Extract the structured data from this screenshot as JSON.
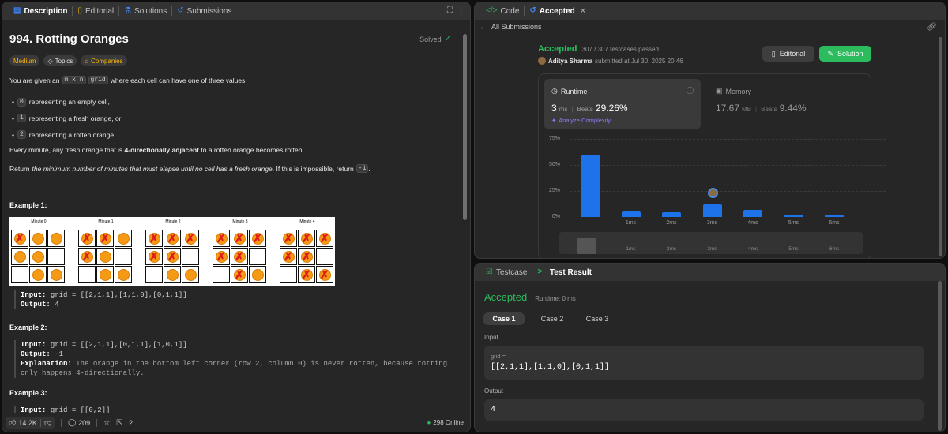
{
  "left_tabs": {
    "description": "Description",
    "editorial": "Editorial",
    "solutions": "Solutions",
    "submissions": "Submissions"
  },
  "problem": {
    "title": "994. Rotting Oranges",
    "solved": "Solved",
    "difficulty": "Medium",
    "topics": "Topics",
    "companies": "Companies",
    "intro_pre": "You are given an",
    "intro_code": "m x n",
    "intro_code2": "grid",
    "intro_post": "where each cell can have one of three values:",
    "bullets": [
      {
        "code": "0",
        "text": "representing an empty cell,"
      },
      {
        "code": "1",
        "text": "representing a fresh orange, or"
      },
      {
        "code": "2",
        "text": "representing a rotten orange."
      }
    ],
    "p2_pre": "Every minute, any fresh orange that is",
    "p2_bold": "4-directionally adjacent",
    "p2_post": "to a rotten orange becomes rotten.",
    "p3_pre": "Return",
    "p3_italic": "the minimum number of minutes that must elapse until no cell has a fresh orange",
    "p3_post": ". If this is impossible, return",
    "p3_code": "-1",
    "p3_end": ".",
    "ex1_title": "Example 1:",
    "minutes": [
      "Minute 0",
      "Minute 1",
      "Minute 2",
      "Minute 3",
      "Minute 4"
    ],
    "ex1_input_label": "Input:",
    "ex1_input": "grid = [[2,1,1],[1,1,0],[0,1,1]]",
    "ex1_output_label": "Output:",
    "ex1_output": "4",
    "ex2_title": "Example 2:",
    "ex2_input_label": "Input:",
    "ex2_input": "grid = [[2,1,1],[0,1,1],[1,0,1]]",
    "ex2_output_label": "Output:",
    "ex2_output": "-1",
    "ex2_expl_label": "Explanation:",
    "ex2_expl_1": "The orange in the bottom left corner (row 2, column 0) is never rotten, because rotting",
    "ex2_expl_2": "only happens 4-directionally.",
    "ex3_title": "Example 3:",
    "ex3_input_label": "Input:",
    "ex3_input": "grid = [[0,2]]"
  },
  "footer": {
    "likes": "14.2K",
    "comments": "209",
    "online": "298 Online"
  },
  "right_tabs": {
    "code": "Code",
    "accepted": "Accepted"
  },
  "submission": {
    "back": "All Submissions",
    "status": "Accepted",
    "passed": "307 / 307 testcases passed",
    "user": "Aditya Sharma",
    "submitted": "submitted at Jul 30, 2025 20:46",
    "editorial_btn": "Editorial",
    "solution_btn": "Solution",
    "runtime_label": "Runtime",
    "runtime_value": "3",
    "runtime_unit": "ms",
    "runtime_beats_label": "Beats",
    "runtime_beats": "29.26%",
    "analyze": "Analyze Complexity",
    "memory_label": "Memory",
    "memory_value": "17.67",
    "memory_unit": "MB",
    "memory_beats_label": "Beats",
    "memory_beats": "9.44%"
  },
  "chart_data": {
    "type": "bar",
    "ytick_labels": [
      "75%",
      "50%",
      "25%",
      "0%"
    ],
    "yticks": [
      75,
      50,
      25,
      0
    ],
    "ylim": [
      0,
      75
    ],
    "x_labels": [
      "1ms",
      "2ms",
      "3ms",
      "4ms",
      "5ms",
      "6ms"
    ],
    "label_positions": [
      1,
      2,
      3,
      4,
      5,
      6
    ],
    "bar_x": [
      0,
      1,
      2,
      3,
      4,
      5,
      6
    ],
    "values": [
      59,
      5.5,
      4.5,
      12,
      6.5,
      2.5,
      2.5
    ],
    "highlight_x": 3,
    "grid": true,
    "bar_color": "#1f73ea"
  },
  "testpanel": {
    "testcase_tab": "Testcase",
    "result_tab": "Test Result",
    "status": "Accepted",
    "runtime": "Runtime: 0 ms",
    "cases": [
      "Case 1",
      "Case 2",
      "Case 3"
    ],
    "input_label": "Input",
    "var_name": "grid =",
    "var_value": "[[2,1,1],[1,1,0],[0,1,1]]",
    "output_label": "Output",
    "output_value": "4"
  },
  "colors": {
    "accent_green": "#2cbb5d",
    "medium": "#ffb800",
    "bar_blue": "#1f73ea"
  }
}
